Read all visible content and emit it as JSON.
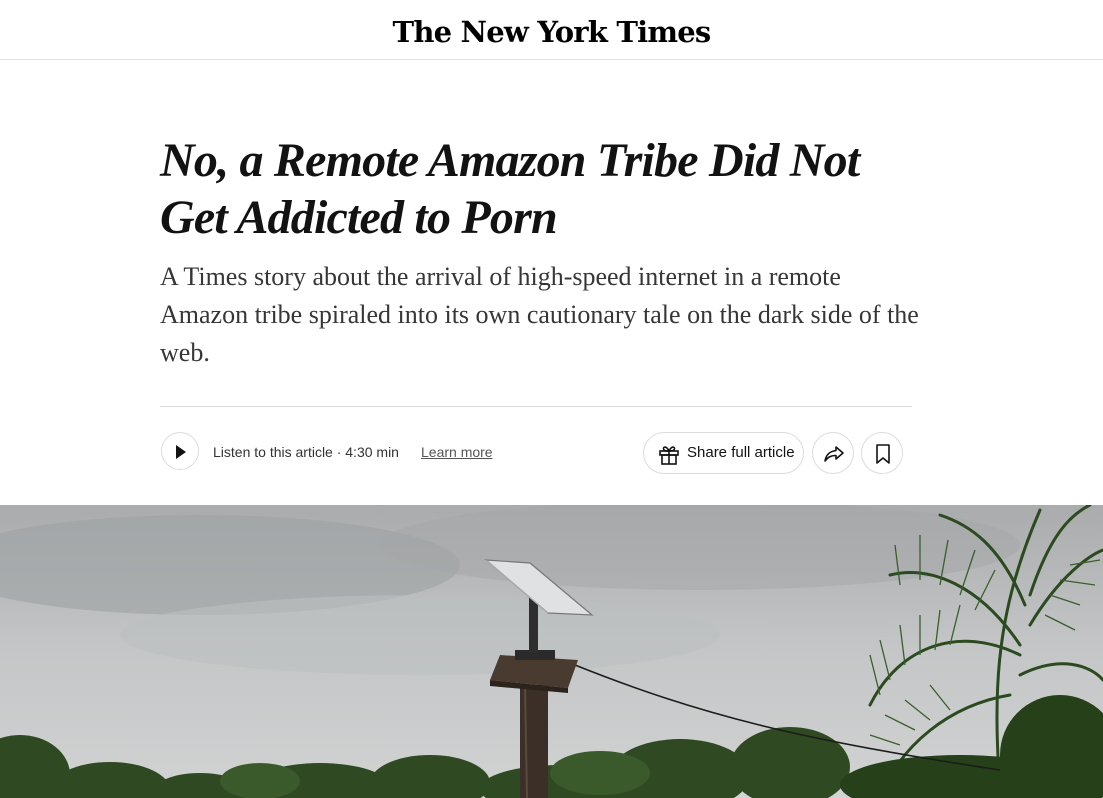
{
  "masthead": {
    "logo_text": "The New York Times",
    "logo_icon": "nyt-wordmark"
  },
  "article": {
    "headline": "No, a Remote Amazon Tribe Did Not Get Addicted to Porn",
    "summary": "A Times story about the arrival of high-speed internet in a remote Amazon tribe spiraled into its own cautionary tale on the dark side of the web."
  },
  "toolbar": {
    "play_icon": "play-icon",
    "listen_text": "Listen to this article · 4:30 min",
    "learn_more": "Learn more",
    "share_label": "Share full article",
    "gift_icon": "gift-icon",
    "forward_icon": "share-arrow-icon",
    "save_icon": "bookmark-icon"
  },
  "colors": {
    "text": "#121212",
    "summary_text": "#363636",
    "border": "#dcdcdc",
    "sky": "#c6c8c9",
    "foliage": "#2f4a22"
  }
}
